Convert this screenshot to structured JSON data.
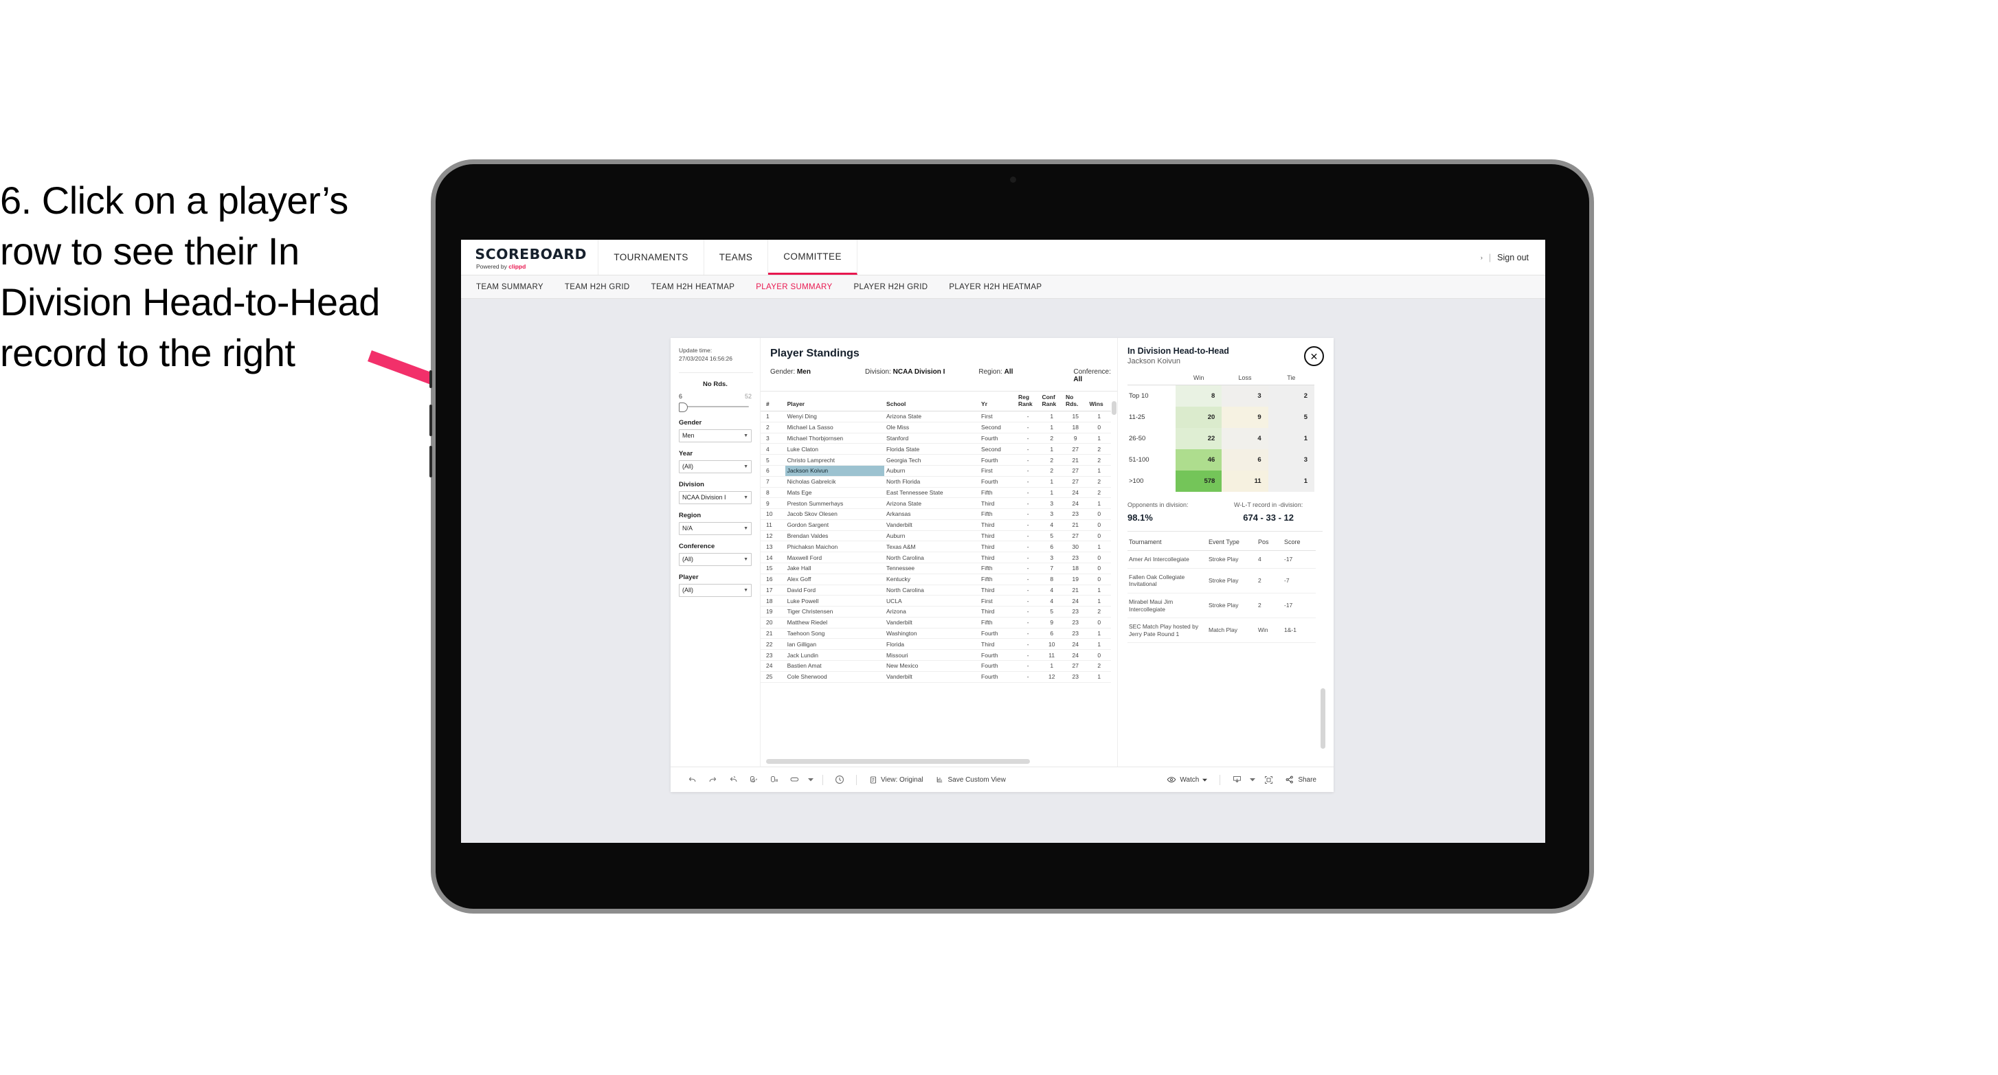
{
  "instruction": "6. Click on a player’s row to see their In Division Head-to-Head record to the right",
  "accent_color": "#e8174f",
  "selection_color": "#9cc2d0",
  "header": {
    "logo_main": "SCOREBOARD",
    "logo_sub_prefix": "Powered by ",
    "logo_sub_brand": "clippd",
    "nav": [
      {
        "label": "TOURNAMENTS",
        "active": false
      },
      {
        "label": "TEAMS",
        "active": false
      },
      {
        "label": "COMMITTEE",
        "active": true
      }
    ],
    "user_caret": "›",
    "separator": "|",
    "sign_out": "Sign out"
  },
  "subnav": [
    {
      "label": "TEAM SUMMARY",
      "active": false
    },
    {
      "label": "TEAM H2H GRID",
      "active": false
    },
    {
      "label": "TEAM H2H HEATMAP",
      "active": false
    },
    {
      "label": "PLAYER SUMMARY",
      "active": true
    },
    {
      "label": "PLAYER H2H GRID",
      "active": false
    },
    {
      "label": "PLAYER H2H HEATMAP",
      "active": false
    }
  ],
  "filters": {
    "update_time_label": "Update time:",
    "update_time_value": "27/03/2024 16:56:26",
    "slider": {
      "label": "No Rds.",
      "min": "6",
      "max": "52"
    },
    "selects": [
      {
        "label": "Gender",
        "value": "Men"
      },
      {
        "label": "Year",
        "value": "(All)"
      },
      {
        "label": "Division",
        "value": "NCAA Division I"
      },
      {
        "label": "Region",
        "value": "N/A"
      },
      {
        "label": "Conference",
        "value": "(All)"
      },
      {
        "label": "Player",
        "value": "(All)"
      }
    ]
  },
  "standings": {
    "title": "Player Standings",
    "summary": [
      {
        "label": "Gender: ",
        "value": "Men"
      },
      {
        "label": "Division: ",
        "value": "NCAA Division I"
      },
      {
        "label": "Region: ",
        "value": "All"
      },
      {
        "label": "Conference: ",
        "value": "All"
      }
    ],
    "columns": [
      "#",
      "Player",
      "School",
      "Yr",
      "Reg Rank",
      "Conf Rank",
      "No Rds.",
      "Wins"
    ],
    "columns_display": {
      "num": "#",
      "player": "Player",
      "school": "School",
      "yr": "Yr",
      "reg1": "Reg",
      "reg2": "Rank",
      "conf1": "Conf",
      "conf2": "Rank",
      "rds1": "No",
      "rds2": "Rds.",
      "wins": "Wins"
    },
    "rows": [
      {
        "num": "1",
        "player": "Wenyi Ding",
        "school": "Arizona State",
        "yr": "First",
        "reg": "-",
        "conf": "1",
        "rds": "15",
        "wins": "1",
        "selected": false
      },
      {
        "num": "2",
        "player": "Michael La Sasso",
        "school": "Ole Miss",
        "yr": "Second",
        "reg": "-",
        "conf": "1",
        "rds": "18",
        "wins": "0",
        "selected": false
      },
      {
        "num": "3",
        "player": "Michael Thorbjornsen",
        "school": "Stanford",
        "yr": "Fourth",
        "reg": "-",
        "conf": "2",
        "rds": "9",
        "wins": "1",
        "selected": false
      },
      {
        "num": "4",
        "player": "Luke Claton",
        "school": "Florida State",
        "yr": "Second",
        "reg": "-",
        "conf": "1",
        "rds": "27",
        "wins": "2",
        "selected": false
      },
      {
        "num": "5",
        "player": "Christo Lamprecht",
        "school": "Georgia Tech",
        "yr": "Fourth",
        "reg": "-",
        "conf": "2",
        "rds": "21",
        "wins": "2",
        "selected": false
      },
      {
        "num": "6",
        "player": "Jackson Koivun",
        "school": "Auburn",
        "yr": "First",
        "reg": "-",
        "conf": "2",
        "rds": "27",
        "wins": "1",
        "selected": true
      },
      {
        "num": "7",
        "player": "Nicholas Gabrelcik",
        "school": "North Florida",
        "yr": "Fourth",
        "reg": "-",
        "conf": "1",
        "rds": "27",
        "wins": "2",
        "selected": false
      },
      {
        "num": "8",
        "player": "Mats Ege",
        "school": "East Tennessee State",
        "yr": "Fifth",
        "reg": "-",
        "conf": "1",
        "rds": "24",
        "wins": "2",
        "selected": false
      },
      {
        "num": "9",
        "player": "Preston Summerhays",
        "school": "Arizona State",
        "yr": "Third",
        "reg": "-",
        "conf": "3",
        "rds": "24",
        "wins": "1",
        "selected": false
      },
      {
        "num": "10",
        "player": "Jacob Skov Olesen",
        "school": "Arkansas",
        "yr": "Fifth",
        "reg": "-",
        "conf": "3",
        "rds": "23",
        "wins": "0",
        "selected": false
      },
      {
        "num": "11",
        "player": "Gordon Sargent",
        "school": "Vanderbilt",
        "yr": "Third",
        "reg": "-",
        "conf": "4",
        "rds": "21",
        "wins": "0",
        "selected": false
      },
      {
        "num": "12",
        "player": "Brendan Valdes",
        "school": "Auburn",
        "yr": "Third",
        "reg": "-",
        "conf": "5",
        "rds": "27",
        "wins": "0",
        "selected": false
      },
      {
        "num": "13",
        "player": "Phichaksn Maichon",
        "school": "Texas A&M",
        "yr": "Third",
        "reg": "-",
        "conf": "6",
        "rds": "30",
        "wins": "1",
        "selected": false
      },
      {
        "num": "14",
        "player": "Maxwell Ford",
        "school": "North Carolina",
        "yr": "Third",
        "reg": "-",
        "conf": "3",
        "rds": "23",
        "wins": "0",
        "selected": false
      },
      {
        "num": "15",
        "player": "Jake Hall",
        "school": "Tennessee",
        "yr": "Fifth",
        "reg": "-",
        "conf": "7",
        "rds": "18",
        "wins": "0",
        "selected": false
      },
      {
        "num": "16",
        "player": "Alex Goff",
        "school": "Kentucky",
        "yr": "Fifth",
        "reg": "-",
        "conf": "8",
        "rds": "19",
        "wins": "0",
        "selected": false
      },
      {
        "num": "17",
        "player": "David Ford",
        "school": "North Carolina",
        "yr": "Third",
        "reg": "-",
        "conf": "4",
        "rds": "21",
        "wins": "1",
        "selected": false
      },
      {
        "num": "18",
        "player": "Luke Powell",
        "school": "UCLA",
        "yr": "First",
        "reg": "-",
        "conf": "4",
        "rds": "24",
        "wins": "1",
        "selected": false
      },
      {
        "num": "19",
        "player": "Tiger Christensen",
        "school": "Arizona",
        "yr": "Third",
        "reg": "-",
        "conf": "5",
        "rds": "23",
        "wins": "2",
        "selected": false
      },
      {
        "num": "20",
        "player": "Matthew Riedel",
        "school": "Vanderbilt",
        "yr": "Fifth",
        "reg": "-",
        "conf": "9",
        "rds": "23",
        "wins": "0",
        "selected": false
      },
      {
        "num": "21",
        "player": "Taehoon Song",
        "school": "Washington",
        "yr": "Fourth",
        "reg": "-",
        "conf": "6",
        "rds": "23",
        "wins": "1",
        "selected": false
      },
      {
        "num": "22",
        "player": "Ian Gilligan",
        "school": "Florida",
        "yr": "Third",
        "reg": "-",
        "conf": "10",
        "rds": "24",
        "wins": "1",
        "selected": false
      },
      {
        "num": "23",
        "player": "Jack Lundin",
        "school": "Missouri",
        "yr": "Fourth",
        "reg": "-",
        "conf": "11",
        "rds": "24",
        "wins": "0",
        "selected": false
      },
      {
        "num": "24",
        "player": "Bastien Amat",
        "school": "New Mexico",
        "yr": "Fourth",
        "reg": "-",
        "conf": "1",
        "rds": "27",
        "wins": "2",
        "selected": false
      },
      {
        "num": "25",
        "player": "Cole Sherwood",
        "school": "Vanderbilt",
        "yr": "Fourth",
        "reg": "-",
        "conf": "12",
        "rds": "23",
        "wins": "1",
        "selected": false
      }
    ]
  },
  "h2h": {
    "title": "In Division Head-to-Head",
    "player": "Jackson Koivun",
    "close_icon": "✕",
    "matrix": {
      "columns": [
        "Win",
        "Loss",
        "Tie"
      ],
      "row_label_header": "",
      "rows": [
        {
          "label": "Top 10",
          "win": "8",
          "loss": "3",
          "tie": "2",
          "win_bg": "#e9f2e3",
          "loss_bg": "#f0efed",
          "tie_bg": "#efefef"
        },
        {
          "label": "11-25",
          "win": "20",
          "loss": "9",
          "tie": "5",
          "win_bg": "#dbebcd",
          "loss_bg": "#f6f2e2",
          "tie_bg": "#efefef"
        },
        {
          "label": "26-50",
          "win": "22",
          "loss": "4",
          "tie": "1",
          "win_bg": "#dfeed3",
          "loss_bg": "#f1f0ec",
          "tie_bg": "#efefef"
        },
        {
          "label": "51-100",
          "win": "46",
          "loss": "6",
          "tie": "3",
          "win_bg": "#aedd8e",
          "loss_bg": "#f4f0e4",
          "tie_bg": "#efefef"
        },
        {
          "label": ">100",
          "win": "578",
          "loss": "11",
          "tie": "1",
          "win_bg": "#74c559",
          "loss_bg": "#f6f1e0",
          "tie_bg": "#efefef"
        }
      ]
    },
    "stats": [
      {
        "label": "Opponents in division:",
        "value": "98.1%"
      },
      {
        "label": "W-L-T record in -division:",
        "value": "674 - 33 - 12"
      }
    ],
    "tournaments": {
      "columns": [
        "Tournament",
        "Event Type",
        "Pos",
        "Score"
      ],
      "rows": [
        {
          "name": "Amer Ari Intercollegiate",
          "type": "Stroke Play",
          "pos": "4",
          "score": "-17"
        },
        {
          "name": "Fallen Oak Collegiate Invitational",
          "type": "Stroke Play",
          "pos": "2",
          "score": "-7"
        },
        {
          "name": "Mirabel Maui Jim Intercollegiate",
          "type": "Stroke Play",
          "pos": "2",
          "score": "-17"
        },
        {
          "name": "SEC Match Play hosted by Jerry Pate Round 1",
          "type": "Match Play",
          "pos": "Win",
          "score": "1&-1"
        }
      ]
    }
  },
  "toolbar": {
    "icons": [
      "undo-icon",
      "redo-icon",
      "revert-icon",
      "refresh-data-icon",
      "pause-updates-icon",
      "device-layout-icon",
      "dropdown-caret-icon",
      "history-icon"
    ],
    "view_label": "View: Original",
    "save_label": "Save Custom View",
    "watch_label": "Watch",
    "share_label": "Share"
  }
}
